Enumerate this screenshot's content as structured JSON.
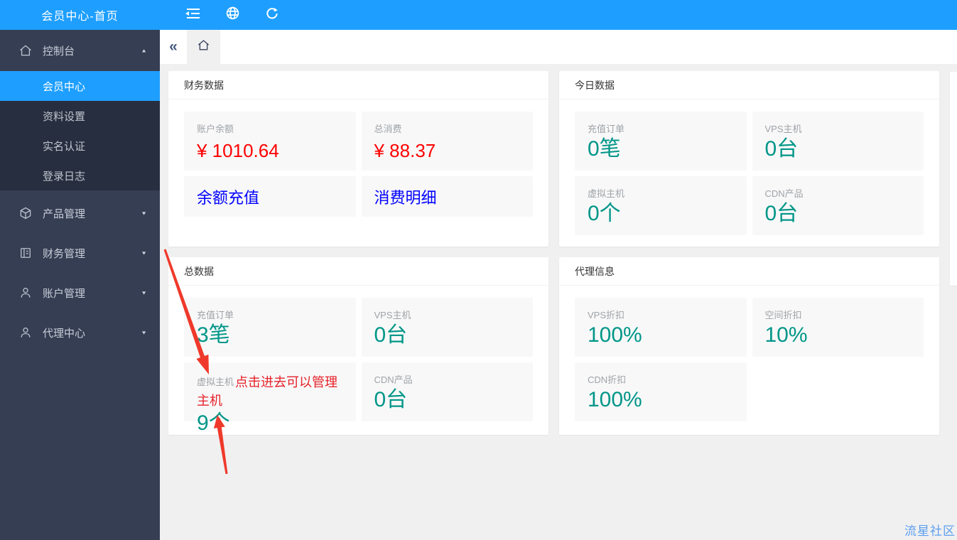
{
  "colors": {
    "accent_blue": "#1e9fff",
    "sidebar_dark": "#353e53",
    "submenu_dark": "#272e3f",
    "stat_teal": "#009688",
    "money_red": "#ff0000",
    "link_blue": "#0000ff",
    "annotation_red": "#e8392b",
    "watermark_blue": "#5b9ff0"
  },
  "header": {
    "title": "会员中心-首页"
  },
  "tabbar": {
    "back_glyph": "«"
  },
  "sidebar": {
    "console": {
      "label": "控制台",
      "caret": "▲"
    },
    "console_children": [
      {
        "label": "会员中心",
        "active": true
      },
      {
        "label": "资料设置",
        "active": false
      },
      {
        "label": "实名认证",
        "active": false
      },
      {
        "label": "登录日志",
        "active": false
      }
    ],
    "groups": [
      {
        "label": "产品管理",
        "icon": "cube-icon",
        "caret": "▼"
      },
      {
        "label": "财务管理",
        "icon": "ledger-icon",
        "caret": "▼"
      },
      {
        "label": "账户管理",
        "icon": "user-icon",
        "caret": "▼"
      },
      {
        "label": "代理中心",
        "icon": "user-icon",
        "caret": "▼"
      }
    ]
  },
  "cards": {
    "finance": {
      "title": "财务数据",
      "stats": [
        {
          "label": "账户余额",
          "value": "¥ 1010.64"
        },
        {
          "label": "总消费",
          "value": "¥ 88.37"
        }
      ],
      "links": [
        {
          "label": "余额充值"
        },
        {
          "label": "消费明细"
        }
      ]
    },
    "today": {
      "title": "今日数据",
      "stats": [
        {
          "label": "充值订单",
          "value": "0笔"
        },
        {
          "label": "VPS主机",
          "value": "0台"
        },
        {
          "label": "虚拟主机",
          "value": "0个"
        },
        {
          "label": "CDN产品",
          "value": "0台"
        }
      ]
    },
    "total": {
      "title": "总数据",
      "stats": [
        {
          "label": "充值订单",
          "value": "3笔"
        },
        {
          "label": "VPS主机",
          "value": "0台"
        },
        {
          "label": "虚拟主机",
          "value": "9个",
          "annotation": "点击进去可以管理主机"
        },
        {
          "label": "CDN产品",
          "value": "0台"
        }
      ]
    },
    "agent": {
      "title": "代理信息",
      "stats": [
        {
          "label": "VPS折扣",
          "value": "100%"
        },
        {
          "label": "空间折扣",
          "value": "10%"
        },
        {
          "label": "CDN折扣",
          "value": "100%"
        }
      ]
    }
  },
  "annotations": {
    "watermark": "流星社区"
  }
}
